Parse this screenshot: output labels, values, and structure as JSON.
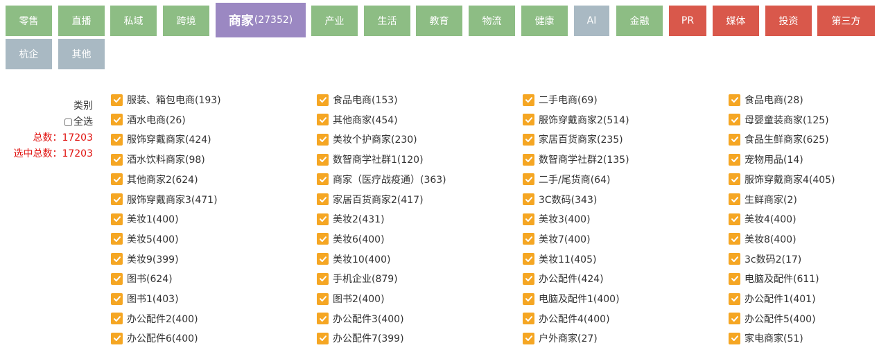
{
  "tabs": [
    {
      "label": "零售",
      "color": "green"
    },
    {
      "label": "直播",
      "color": "green"
    },
    {
      "label": "私域",
      "color": "green"
    },
    {
      "label": "跨境",
      "color": "green"
    },
    {
      "label": "商家",
      "count": "(27352)",
      "color": "purple",
      "active": true
    },
    {
      "label": "产业",
      "color": "green"
    },
    {
      "label": "生活",
      "color": "green"
    },
    {
      "label": "教育",
      "color": "green"
    },
    {
      "label": "物流",
      "color": "green"
    },
    {
      "label": "健康",
      "color": "green"
    },
    {
      "label": "AI",
      "color": "gray"
    },
    {
      "label": "金融",
      "color": "green"
    },
    {
      "label": "PR",
      "color": "red"
    },
    {
      "label": "媒体",
      "color": "red"
    },
    {
      "label": "投资",
      "color": "red"
    },
    {
      "label": "第三方",
      "color": "red"
    },
    {
      "label": "杭企",
      "color": "gray"
    },
    {
      "label": "其他",
      "color": "gray"
    }
  ],
  "left_panel": {
    "category_label": "类别",
    "select_all_label": "全选",
    "total_label": "总数：17203",
    "selected_total_label": "选中总数：17203"
  },
  "colors": {
    "green": "#8dbd84",
    "gray": "#a9b9c3",
    "red": "#d9584b",
    "purple": "#9b88c2",
    "checkbox": "#f5a623",
    "count_text": "#e0120f"
  },
  "categories": [
    [
      "服装、箱包电商(193)",
      "食品电商(153)",
      "二手电商(69)",
      "食品电商(28)"
    ],
    [
      "酒水电商(26)",
      "其他商家(454)",
      "服饰穿戴商家2(514)",
      "母婴童装商家(125)"
    ],
    [
      "服饰穿戴商家(424)",
      "美妆个护商家(230)",
      "家居百货商家(235)",
      "食品生鲜商家(625)"
    ],
    [
      "酒水饮料商家(98)",
      "数智商学社群1(120)",
      "数智商学社群2(135)",
      "宠物用品(14)"
    ],
    [
      "其他商家2(624)",
      "商家（医疗战疫通）(363)",
      "二手/尾货商(64)",
      "服饰穿戴商家4(405)"
    ],
    [
      "服饰穿戴商家3(471)",
      "家居百货商家2(417)",
      "3C数码(343)",
      "生鲜商家(2)"
    ],
    [
      "美妆1(400)",
      "美妆2(431)",
      "美妆3(400)",
      "美妆4(400)"
    ],
    [
      "美妆5(400)",
      "美妆6(400)",
      "美妆7(400)",
      "美妆8(400)"
    ],
    [
      "美妆9(399)",
      "美妆10(400)",
      "美妆11(405)",
      "3c数码2(17)"
    ],
    [
      "图书(624)",
      "手机企业(879)",
      "办公配件(424)",
      "电脑及配件(611)"
    ],
    [
      "图书1(403)",
      "图书2(400)",
      "电脑及配件1(400)",
      "办公配件1(401)"
    ],
    [
      "办公配件2(400)",
      "办公配件3(400)",
      "办公配件4(400)",
      "办公配件5(400)"
    ],
    [
      "办公配件6(400)",
      "办公配件7(399)",
      "户外商家(27)",
      "家电商家(51)"
    ]
  ]
}
